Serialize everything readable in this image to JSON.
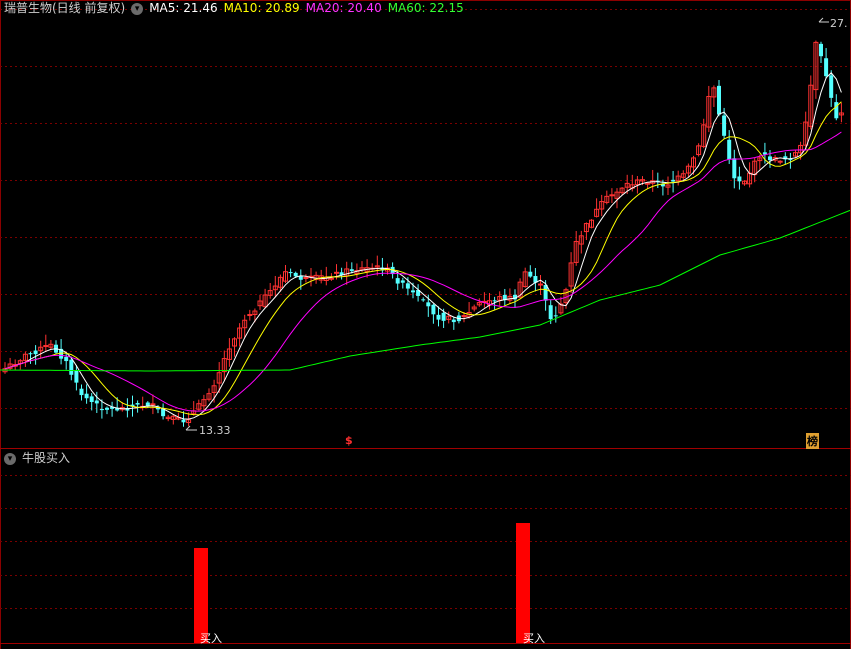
{
  "main_panel": {
    "stock_name": "瑞普生物(日线 前复权)",
    "ma5_label": "MA5: 21.46",
    "ma10_label": "MA10: 20.89",
    "ma20_label": "MA20: 20.40",
    "ma60_label": "MA60: 22.15",
    "colors": {
      "ma5": "#ffffff",
      "ma10": "#ffff00",
      "ma20": "#ff00ff",
      "ma60": "#00ff00",
      "up": "#ff3232",
      "down": "#54ffff"
    },
    "high_marker": "27.",
    "low_marker": "13.33",
    "marker_dollar": "$",
    "marker_bang": "榜"
  },
  "sub_panel": {
    "indicator_name": "牛股买入",
    "buy_label_1": "买入",
    "buy_label_2": "买入"
  },
  "chart_data": [
    {
      "type": "candlestick",
      "title": "瑞普生物(日线 前复权)",
      "series": [
        {
          "name": "MA5",
          "value": 21.46
        },
        {
          "name": "MA10",
          "value": 20.89
        },
        {
          "name": "MA20",
          "value": 20.4
        },
        {
          "name": "MA60",
          "value": 22.15
        }
      ],
      "annotations": [
        "27.",
        "13.33",
        "$",
        "榜"
      ]
    },
    {
      "type": "bar",
      "title": "牛股买入",
      "categories": [
        "买入",
        "买入"
      ]
    }
  ]
}
